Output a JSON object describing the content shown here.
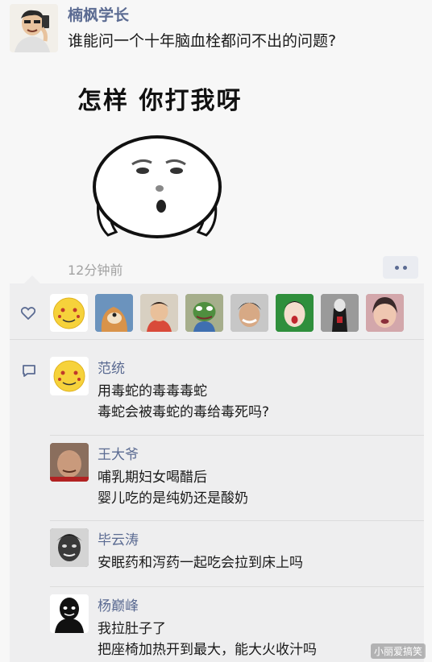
{
  "post": {
    "author": "楠枫学长",
    "text": "谁能问一个十年脑血栓都问不出的问题?",
    "meme_caption": "怎样 你打我呀",
    "timestamp": "12分钟前"
  },
  "comments": [
    {
      "name": "范统",
      "lines": [
        "用毒蛇的毒毒毒蛇",
        "毒蛇会被毒蛇的毒给毒死吗?"
      ]
    },
    {
      "name": "王大爷",
      "lines": [
        "哺乳期妇女喝醋后",
        "婴儿吃的是纯奶还是酸奶"
      ]
    },
    {
      "name": "毕云涛",
      "lines": [
        "安眠药和泻药一起吃会拉到床上吗"
      ]
    },
    {
      "name": "杨巅峰",
      "lines": [
        "我拉肚子了",
        "把座椅加热开到最大，能大火收汁吗"
      ]
    }
  ],
  "watermark": "小丽爱搞笑",
  "colors": {
    "name_blue": "#5b6b92",
    "panel_bg": "#eeeeef",
    "page_bg": "#f7f7f7"
  },
  "icons": {
    "like": "heart-icon",
    "comment": "comment-bubble-icon",
    "more": "more-dots-icon"
  }
}
